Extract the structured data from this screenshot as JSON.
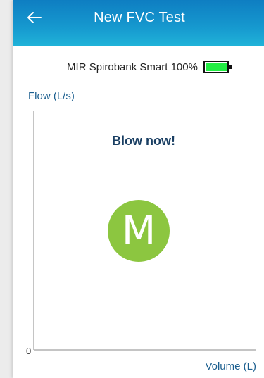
{
  "header": {
    "title": "New FVC Test",
    "back_icon": "arrow-left-icon",
    "gradient_colors": [
      "#0e7ec2",
      "#20b2d8"
    ]
  },
  "device": {
    "status_text": "MIR Spirobank Smart 100%",
    "battery_level_percent": 100,
    "battery_color": "#22ee44"
  },
  "chart": {
    "y_axis_label": "Flow (L/s)",
    "x_axis_label": "Volume (L)",
    "origin_label": "0",
    "prompt": "Blow now!"
  },
  "logo": {
    "letter": "M",
    "color": "#8cc640"
  },
  "chart_data": {
    "type": "line",
    "series": [],
    "xlabel": "Volume (L)",
    "ylabel": "Flow (L/s)",
    "origin": 0,
    "grid": false
  }
}
